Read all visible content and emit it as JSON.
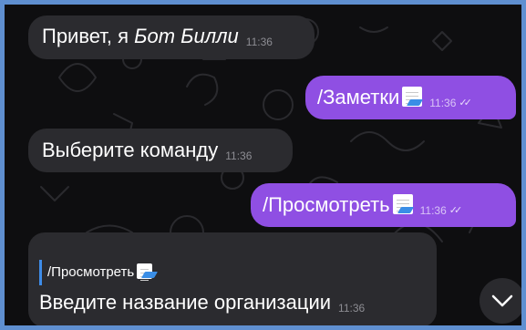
{
  "chat": {
    "messages": [
      {
        "direction": "in",
        "text_plain": "Привет, я ",
        "text_italic": "Бот Билли",
        "time": "11:36"
      },
      {
        "direction": "out",
        "text": "/Заметки",
        "sticker": "memo-icon",
        "time": "11:36",
        "status": "read"
      },
      {
        "direction": "in",
        "text": "Выберите команду",
        "time": "11:36"
      },
      {
        "direction": "out",
        "text": "/Просмотреть",
        "sticker": "memo-icon",
        "time": "11:36",
        "status": "read"
      },
      {
        "direction": "in",
        "reply_to": "/Просмотреть",
        "reply_icon": "memo-icon",
        "text": "Введите название организации",
        "time": "11:36"
      }
    ],
    "scroll_down_icon": "chevron-down-icon"
  },
  "colors": {
    "background": "#0e0e10",
    "incoming_bubble": "#2b2b2f",
    "outgoing_bubble": "#8f4fe3",
    "reply_accent": "#3e8ce8",
    "frame_border": "#5f8fd0"
  }
}
